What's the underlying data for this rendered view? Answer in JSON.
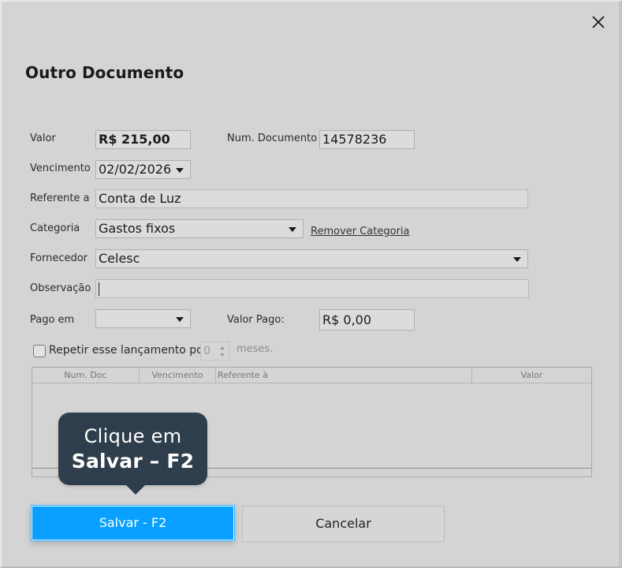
{
  "dialog": {
    "title": "Outro Documento",
    "close_icon": "close-icon"
  },
  "form": {
    "valor": {
      "label": "Valor",
      "value": "R$ 215,00"
    },
    "num_documento": {
      "label": "Num. Documento",
      "value": "14578236"
    },
    "vencimento": {
      "label": "Vencimento",
      "value": "02/02/2026"
    },
    "referente": {
      "label": "Referente a",
      "value": "Conta de Luz"
    },
    "categoria": {
      "label": "Categoria",
      "value": "Gastos fixos",
      "remove_link": "Remover Categoria"
    },
    "fornecedor": {
      "label": "Fornecedor",
      "value": "Celesc"
    },
    "observacao": {
      "label": "Observação",
      "value": ""
    },
    "pago_em": {
      "label": "Pago em",
      "value": ""
    },
    "valor_pago": {
      "label": "Valor Pago:",
      "value": "R$ 0,00"
    },
    "repetir": {
      "label": "Repetir esse lançamento por",
      "spinner_value": "0",
      "suffix": "meses."
    }
  },
  "table": {
    "columns": [
      "Num. Doc",
      "Vencimento",
      "Referente à",
      "Valor"
    ],
    "rows": []
  },
  "buttons": {
    "save_label": "Salvar - F2",
    "cancel_label": "Cancelar"
  },
  "tooltip": {
    "line1": "Clique em",
    "line2": "Salvar – F2"
  },
  "colors": {
    "accent": "#0aa0ff",
    "tooltip_bg": "#2f3e4c",
    "dialog_bg": "#d4d4d4"
  }
}
